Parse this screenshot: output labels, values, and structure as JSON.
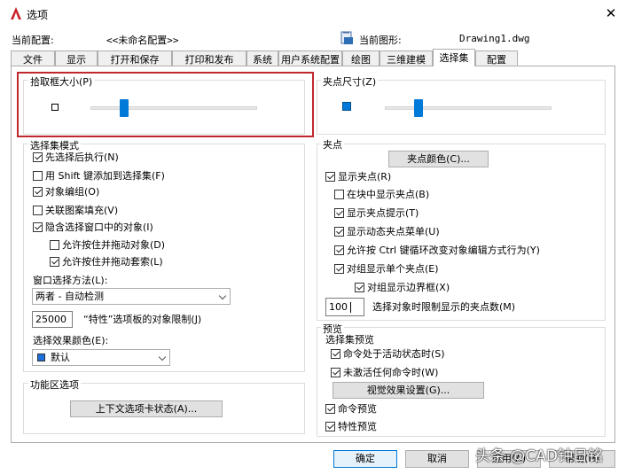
{
  "window": {
    "title": "选项",
    "close_symbol": "✕"
  },
  "header": {
    "profile_label": "当前配置:",
    "profile_value": "<<未命名配置>>",
    "drawing_label": "当前图形:",
    "drawing_value": "Drawing1.dwg"
  },
  "tabs": [
    {
      "label": "文件"
    },
    {
      "label": "显示"
    },
    {
      "label": "打开和保存"
    },
    {
      "label": "打印和发布"
    },
    {
      "label": "系统"
    },
    {
      "label": "用户系统配置"
    },
    {
      "label": "绘图"
    },
    {
      "label": "三维建模"
    },
    {
      "label": "选择集",
      "active": true
    },
    {
      "label": "配置"
    }
  ],
  "pickbox": {
    "label": "拾取框大小(P)",
    "slider_level": 0.2
  },
  "grip_size": {
    "label": "夹点尺寸(Z)",
    "slider_level": 0.2
  },
  "selection_modes": {
    "label": "选择集模式",
    "options": [
      {
        "label": "先选择后执行(N)",
        "checked": true
      },
      {
        "label": "用 Shift 键添加到选择集(F)",
        "checked": false
      },
      {
        "label": "对象编组(O)",
        "checked": true
      },
      {
        "label": "关联图案填充(V)",
        "checked": false
      },
      {
        "label": "隐含选择窗口中的对象(I)",
        "checked": true
      },
      {
        "label": "允许按住并拖动对象(D)",
        "checked": false
      },
      {
        "label": "允许按住并拖动套索(L)",
        "checked": true
      }
    ],
    "window_method_label": "窗口选择方法(L):",
    "window_method_value": "两者 - 自动检测",
    "object_limit_value": "25000",
    "object_limit_label": "“特性”选项板的对象限制(J)",
    "effect_color_label": "选择效果颜色(E):",
    "effect_color_value": "默认",
    "effect_color_swatch": "#1e6fd9"
  },
  "ribbon": {
    "label": "功能区选项",
    "button_label": "上下文选项卡状态(A)..."
  },
  "grips": {
    "label": "夹点",
    "color_button": "夹点颜色(C)...",
    "options": [
      {
        "label": "显示夹点(R)",
        "checked": true
      },
      {
        "label": "在块中显示夹点(B)",
        "checked": false
      },
      {
        "label": "显示夹点提示(T)",
        "checked": true
      },
      {
        "label": "显示动态夹点菜单(U)",
        "checked": true
      },
      {
        "label": "允许按 Ctrl 键循环改变对象编辑方式行为(Y)",
        "checked": true
      },
      {
        "label": "对组显示单个夹点(E)",
        "checked": true
      },
      {
        "label": "对组显示边界框(X)",
        "checked": true
      }
    ],
    "limit_value": "100",
    "limit_label": "选择对象时限制显示的夹点数(M)"
  },
  "preview": {
    "label": "预览",
    "sub_label": "选择集预览",
    "options": [
      {
        "label": "命令处于活动状态时(S)",
        "checked": true
      },
      {
        "label": "未激活任何命令时(W)",
        "checked": true
      }
    ],
    "visual_button": "视觉效果设置(G)...",
    "command_preview": {
      "label": "命令预览",
      "checked": true
    },
    "property_preview": {
      "label": "特性预览",
      "checked": true
    }
  },
  "footer": {
    "ok": "确定",
    "cancel": "取消",
    "apply": "应用(A)",
    "help": "帮助(H)"
  },
  "watermark": "头条 @CAD钟日铭",
  "colors": {
    "accent": "#007ad9",
    "highlight_border": "#c0282e",
    "app_icon": "#c8202a"
  }
}
